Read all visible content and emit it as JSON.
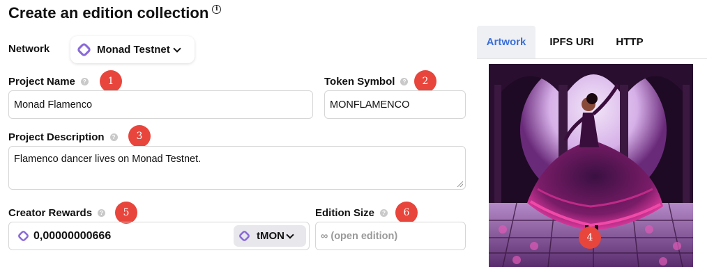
{
  "page": {
    "title": "Create an edition collection"
  },
  "network": {
    "label": "Network",
    "selected": "Monad Testnet"
  },
  "project_name": {
    "label": "Project Name",
    "value": "Monad Flamenco",
    "badge": "1"
  },
  "token_symbol": {
    "label": "Token Symbol",
    "value": "MONFLAMENCO",
    "badge": "2"
  },
  "project_description": {
    "label": "Project Description",
    "value": "Flamenco dancer lives on Monad Testnet.",
    "badge": "3"
  },
  "creator_rewards": {
    "label": "Creator Rewards",
    "value": "0,00000000666",
    "token": "tMON",
    "badge": "5"
  },
  "edition_size": {
    "label": "Edition Size",
    "placeholder": "∞ (open edition)",
    "badge": "6"
  },
  "media_tabs": [
    "Artwork",
    "IPFS URI",
    "HTTP"
  ],
  "artwork": {
    "badge": "4"
  },
  "colors": {
    "accent": "#3a6fd8",
    "badge": "#e8453c",
    "monad": "#8a6ad8"
  },
  "icons": [
    "info-icon",
    "help-icon",
    "monad-icon",
    "chevron-down-icon"
  ]
}
